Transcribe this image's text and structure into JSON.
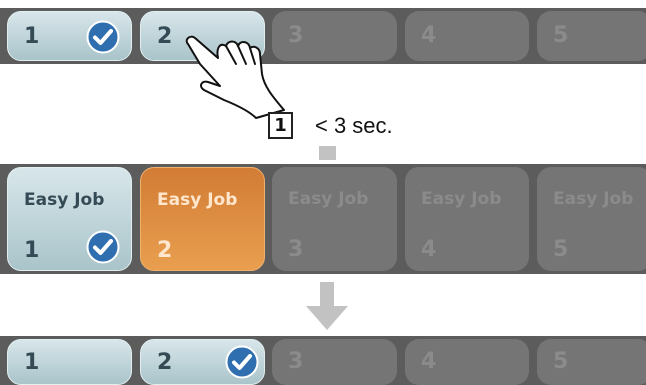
{
  "colors": {
    "strip": "#5c5c5c",
    "tab_active": "#a9c4ca",
    "tab_inactive": "#757575",
    "tab_orange": "#e08f42",
    "check_fill": "#2f6fb0",
    "arrow": "#c2c2c2"
  },
  "top_row": {
    "tabs": [
      {
        "number": "1",
        "state": "active",
        "checked": true
      },
      {
        "number": "2",
        "state": "active",
        "checked": false
      },
      {
        "number": "3",
        "state": "inactive",
        "checked": false
      },
      {
        "number": "4",
        "state": "inactive",
        "checked": false
      },
      {
        "number": "5",
        "state": "inactive",
        "checked": false
      }
    ]
  },
  "step": {
    "number": "1",
    "text": "< 3 sec."
  },
  "middle_row": {
    "tabs": [
      {
        "title": "Easy Job",
        "number": "1",
        "state": "active",
        "checked": true
      },
      {
        "title": "Easy Job",
        "number": "2",
        "state": "orange",
        "checked": false
      },
      {
        "title": "Easy Job",
        "number": "3",
        "state": "inactive",
        "checked": false
      },
      {
        "title": "Easy Job",
        "number": "4",
        "state": "inactive",
        "checked": false
      },
      {
        "title": "Easy Job",
        "number": "5",
        "state": "inactive",
        "checked": false
      }
    ]
  },
  "bottom_row": {
    "tabs": [
      {
        "number": "1",
        "state": "active",
        "checked": false
      },
      {
        "number": "2",
        "state": "active",
        "checked": true
      },
      {
        "number": "3",
        "state": "inactive",
        "checked": false
      },
      {
        "number": "4",
        "state": "inactive",
        "checked": false
      },
      {
        "number": "5",
        "state": "inactive",
        "checked": false
      }
    ]
  },
  "icons": {
    "check": "checkmark-circle-icon",
    "hand": "tap-hand-icon",
    "arrow": "down-arrow-icon"
  }
}
